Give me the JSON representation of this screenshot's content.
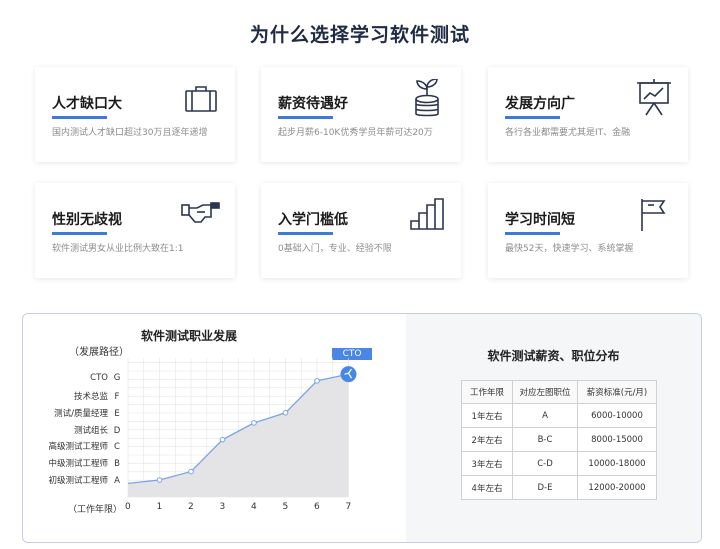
{
  "title": "为什么选择学习软件测试",
  "cards": [
    {
      "title": "人才缺口大",
      "desc": "国内测试人才缺口超过30万且逐年递增",
      "icon": "briefcase-icon"
    },
    {
      "title": "薪资待遇好",
      "desc": "起步月薪6-10K优秀学员年薪可达20万",
      "icon": "money-plant-icon"
    },
    {
      "title": "发展方向广",
      "desc": "各行各业都需要尤其是IT、金融",
      "icon": "presentation-board-icon"
    },
    {
      "title": "性别无歧视",
      "desc": "软件测试男女从业比例大致在1:1",
      "icon": "handshake-icon"
    },
    {
      "title": "入学门槛低",
      "desc": "0基础入门，专业、经验不限",
      "icon": "stairs-icon"
    },
    {
      "title": "学习时间短",
      "desc": "最快52天，快速学习、系统掌握",
      "icon": "flag-icon"
    }
  ],
  "career": {
    "title": "软件测试职业发展",
    "path_label": "（发展路径）",
    "y_labels": [
      {
        "name": "初级测试工程师",
        "code": "A"
      },
      {
        "name": "中级测试工程师",
        "code": "B"
      },
      {
        "name": "高级测试工程师",
        "code": "C"
      },
      {
        "name": "测试组长",
        "code": "D"
      },
      {
        "name": "测试/质量经理",
        "code": "E"
      },
      {
        "name": "技术总监",
        "code": "F"
      },
      {
        "name": "CTO",
        "code": "G"
      }
    ],
    "x_label": "（工作年限）",
    "x_ticks": [
      "0",
      "1",
      "2",
      "3",
      "4",
      "5",
      "6",
      "7"
    ],
    "cto_tag": "CTO"
  },
  "chart_data": {
    "type": "area",
    "title": "软件测试职业发展",
    "xlabel": "（工作年限）",
    "ylabel": "（发展路径）",
    "x": [
      0,
      1,
      2,
      3,
      4,
      5,
      6,
      7
    ],
    "y": [
      -0.2,
      0.0,
      0.5,
      2.4,
      3.4,
      4.0,
      5.9,
      6.3
    ],
    "y_categories": [
      "A",
      "B",
      "C",
      "D",
      "E",
      "F",
      "G"
    ],
    "xlim": [
      0,
      7
    ],
    "ylim": [
      -0.5,
      6.5
    ],
    "grid": true,
    "colors": {
      "line": "#7aa3e8",
      "fill": "#e4e4e6",
      "marker": "#4a86e8"
    }
  },
  "salary": {
    "title": "软件测试薪资、职位分布",
    "headers": [
      "工作年限",
      "对应左图职位",
      "薪资标准(元/月)"
    ],
    "rows": [
      [
        "1年左右",
        "A",
        "6000-10000"
      ],
      [
        "2年左右",
        "B-C",
        "8000-15000"
      ],
      [
        "3年左右",
        "C-D",
        "10000-18000"
      ],
      [
        "4年左右",
        "D-E",
        "12000-20000"
      ]
    ]
  },
  "colors": {
    "accent": "#3d7ad9",
    "title": "#1f2a44"
  }
}
